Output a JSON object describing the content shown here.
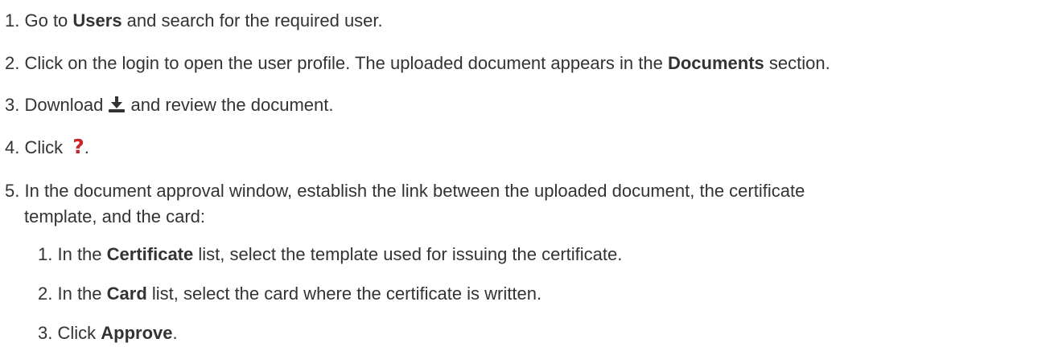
{
  "steps": [
    {
      "num": "1.",
      "pre": "Go to ",
      "bold": "Users",
      "post": " and search for the required user."
    },
    {
      "num": "2.",
      "pre": "Click on the login to open the user profile. The uploaded document appears in the ",
      "bold": "Documents",
      "post": " section."
    },
    {
      "num": "3.",
      "pre": "Download ",
      "icon": "download-icon",
      "post": " and review the document."
    },
    {
      "num": "4.",
      "pre": "Click ",
      "icon": "question-icon",
      "post": "."
    },
    {
      "num": "5.",
      "line1": "In the document approval window, establish the link between the uploaded document, the certificate",
      "line2": "template, and the card:"
    }
  ],
  "substeps": [
    {
      "num": "1.",
      "pre": "In the ",
      "bold": "Certificate",
      "post": " list, select the template used for issuing the certificate."
    },
    {
      "num": "2.",
      "pre": "In the ",
      "bold": "Card",
      "post": " list, select the card where the certificate is written."
    },
    {
      "num": "3.",
      "pre": "Click ",
      "bold": "Approve",
      "post": "."
    }
  ],
  "icons": {
    "question_glyph": "?",
    "download_color": "#333333",
    "question_color": "#c62828"
  }
}
